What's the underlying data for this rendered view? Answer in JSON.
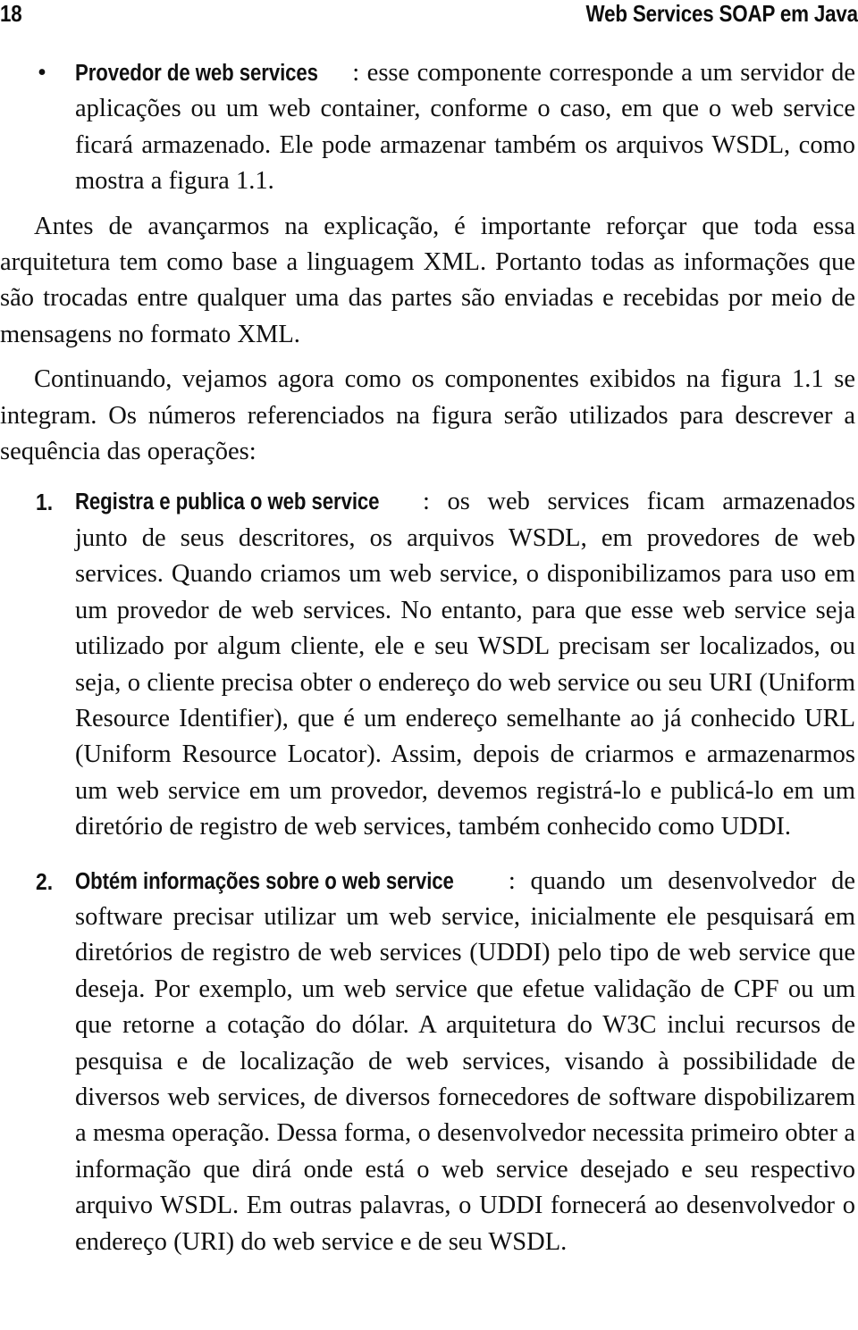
{
  "running_head": {
    "folio": "18",
    "title": "Web Services SOAP em Java"
  },
  "bullet_list": {
    "marker": "•",
    "items": [
      {
        "lead": "Provedor de web services",
        "text": ": esse componente corresponde a um servidor de aplicações ou um web container, conforme o caso, em que o web service ficará armazenado. Ele pode armazenar também os arquivos WSDL, como mostra a figura 1.1."
      }
    ]
  },
  "paragraphs": [
    {
      "id": "para-xml",
      "text": "Antes de avançarmos na explicação, é importante reforçar que toda essa arquitetura tem como base a linguagem XML. Portanto todas as informações que são trocadas entre qualquer uma das partes são enviadas e recebidas por meio de mensagens no formato XML."
    },
    {
      "id": "para-continuando",
      "text": "Continuando, vejamos agora como os componentes exibidos na figura 1.1 se integram. Os números referenciados na figura serão utilizados para descrever a sequência das operações:"
    }
  ],
  "numbered_list": {
    "items": [
      {
        "marker": "1.",
        "lead": "Registra e publica o web service",
        "text": ": os web services ficam armazenados junto de seus descritores, os arquivos WSDL, em provedores de web services. Quando criamos um web service, o disponibilizamos para uso em um provedor de web services. No entanto, para que esse web service seja utilizado por algum cliente, ele e seu WSDL precisam ser localizados, ou seja, o cliente precisa obter o endereço do web service ou seu URI (Uniform Resource Identifier), que é um endereço semelhante ao já conhecido URL (Uniform Resource Locator). Assim, depois de criarmos e armazenarmos um web service em um provedor, devemos registrá-lo e publicá-lo em um diretório de registro de web services, também conhecido como UDDI."
      },
      {
        "marker": "2.",
        "lead": "Obtém informações sobre o web service",
        "text": ": quando um desenvolvedor de software precisar utilizar um web service, inicialmente ele pesquisará em diretórios de registro de web services (UDDI) pelo tipo de web service que deseja. Por exemplo, um web service que efetue validação de CPF ou um que retorne a cotação do dólar. A arquitetura do W3C inclui recursos de pesquisa e de localização de web services, visando à possibilidade de diversos web services, de diversos fornecedores de software dispobilizarem a mesma operação. Dessa forma, o desenvolvedor necessita primeiro obter a informação que dirá onde está o web service desejado e seu respectivo arquivo WSDL. Em outras palavras, o UDDI fornecerá ao desenvolvedor o endereço (URI) do web service e de seu WSDL."
      }
    ]
  }
}
